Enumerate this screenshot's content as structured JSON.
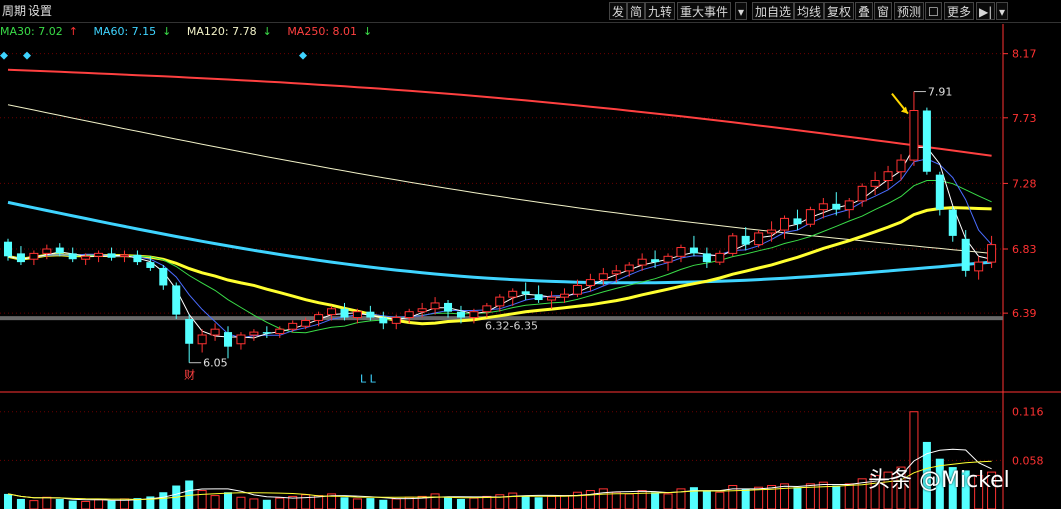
{
  "toolbar": {
    "left": [
      "周期",
      "设置"
    ],
    "right": [
      "发",
      "简",
      "九转",
      "重大事件",
      "▾",
      "加自选",
      "均线",
      "复权",
      "叠",
      "窗",
      "预测",
      "☐",
      "更多",
      "▶|",
      "▾"
    ]
  },
  "legend": [
    {
      "label": "MA30: 7.02",
      "arrow": "↑",
      "color": "#3adc48"
    },
    {
      "label": "MA60: 7.15",
      "arrow": "↓",
      "color": "#3fd4ff"
    },
    {
      "label": "MA120: 7.78",
      "arrow": "↓",
      "color": "#f2f2c8"
    },
    {
      "label": "MA250: 8.01",
      "arrow": "↓",
      "color": "#ff4040"
    }
  ],
  "colors": {
    "up": "#ff3232",
    "down": "#54ffff",
    "grid": "#6b0000",
    "axis": "#ff3232"
  },
  "chart_data": {
    "type": "candlestick",
    "y_ticks": [
      "8.17",
      "7.73",
      "7.28",
      "6.83",
      "6.39"
    ],
    "ylim": [
      6.0,
      8.25
    ],
    "volume_ticks": [
      "0.116",
      "0.058"
    ],
    "volume_ylim": [
      0,
      0.13
    ],
    "annotations": {
      "high": "7.91",
      "low": "6.05",
      "range": "6.32-6.35",
      "finance_marker": "财",
      "low_marks": "L L"
    },
    "candles": [
      [
        6.88,
        6.9,
        6.75,
        6.78
      ],
      [
        6.8,
        6.85,
        6.72,
        6.74
      ],
      [
        6.76,
        6.82,
        6.72,
        6.8
      ],
      [
        6.8,
        6.86,
        6.76,
        6.83
      ],
      [
        6.84,
        6.87,
        6.78,
        6.8
      ],
      [
        6.8,
        6.84,
        6.74,
        6.76
      ],
      [
        6.76,
        6.8,
        6.72,
        6.78
      ],
      [
        6.78,
        6.82,
        6.74,
        6.8
      ],
      [
        6.8,
        6.84,
        6.75,
        6.77
      ],
      [
        6.78,
        6.82,
        6.74,
        6.79
      ],
      [
        6.79,
        6.82,
        6.72,
        6.74
      ],
      [
        6.74,
        6.78,
        6.68,
        6.7
      ],
      [
        6.7,
        6.72,
        6.55,
        6.58
      ],
      [
        6.58,
        6.6,
        6.35,
        6.38
      ],
      [
        6.35,
        6.38,
        6.05,
        6.18
      ],
      [
        6.18,
        6.28,
        6.12,
        6.24
      ],
      [
        6.24,
        6.32,
        6.2,
        6.28
      ],
      [
        6.26,
        6.3,
        6.08,
        6.16
      ],
      [
        6.18,
        6.26,
        6.14,
        6.24
      ],
      [
        6.24,
        6.28,
        6.2,
        6.26
      ],
      [
        6.26,
        6.3,
        6.22,
        6.25
      ],
      [
        6.25,
        6.3,
        6.22,
        6.28
      ],
      [
        6.28,
        6.34,
        6.26,
        6.32
      ],
      [
        6.3,
        6.36,
        6.28,
        6.34
      ],
      [
        6.34,
        6.4,
        6.3,
        6.38
      ],
      [
        6.38,
        6.44,
        6.34,
        6.42
      ],
      [
        6.42,
        6.46,
        6.34,
        6.36
      ],
      [
        6.36,
        6.42,
        6.32,
        6.4
      ],
      [
        6.4,
        6.44,
        6.34,
        6.36
      ],
      [
        6.36,
        6.4,
        6.28,
        6.32
      ],
      [
        6.32,
        6.38,
        6.28,
        6.36
      ],
      [
        6.36,
        6.42,
        6.32,
        6.4
      ],
      [
        6.4,
        6.46,
        6.36,
        6.42
      ],
      [
        6.42,
        6.5,
        6.38,
        6.46
      ],
      [
        6.46,
        6.48,
        6.36,
        6.4
      ],
      [
        6.4,
        6.44,
        6.32,
        6.36
      ],
      [
        6.36,
        6.42,
        6.32,
        6.4
      ],
      [
        6.4,
        6.46,
        6.36,
        6.44
      ],
      [
        6.44,
        6.52,
        6.4,
        6.5
      ],
      [
        6.5,
        6.56,
        6.44,
        6.54
      ],
      [
        6.54,
        6.6,
        6.48,
        6.52
      ],
      [
        6.52,
        6.58,
        6.46,
        6.48
      ],
      [
        6.48,
        6.54,
        6.42,
        6.5
      ],
      [
        6.5,
        6.56,
        6.46,
        6.52
      ],
      [
        6.52,
        6.62,
        6.5,
        6.58
      ],
      [
        6.58,
        6.66,
        6.54,
        6.62
      ],
      [
        6.62,
        6.7,
        6.58,
        6.66
      ],
      [
        6.66,
        6.72,
        6.6,
        6.68
      ],
      [
        6.68,
        6.74,
        6.64,
        6.72
      ],
      [
        6.72,
        6.8,
        6.68,
        6.76
      ],
      [
        6.76,
        6.82,
        6.7,
        6.74
      ],
      [
        6.74,
        6.8,
        6.68,
        6.78
      ],
      [
        6.78,
        6.86,
        6.74,
        6.84
      ],
      [
        6.84,
        6.92,
        6.78,
        6.8
      ],
      [
        6.8,
        6.84,
        6.7,
        6.74
      ],
      [
        6.74,
        6.82,
        6.72,
        6.8
      ],
      [
        6.8,
        6.94,
        6.78,
        6.92
      ],
      [
        6.92,
        6.98,
        6.82,
        6.86
      ],
      [
        6.86,
        6.96,
        6.84,
        6.94
      ],
      [
        6.94,
        7.02,
        6.88,
        6.96
      ],
      [
        6.96,
        7.06,
        6.9,
        7.04
      ],
      [
        7.04,
        7.1,
        6.96,
        7.0
      ],
      [
        7.0,
        7.12,
        6.98,
        7.1
      ],
      [
        7.1,
        7.18,
        7.04,
        7.14
      ],
      [
        7.14,
        7.22,
        7.06,
        7.1
      ],
      [
        7.1,
        7.18,
        7.04,
        7.16
      ],
      [
        7.16,
        7.28,
        7.12,
        7.26
      ],
      [
        7.26,
        7.36,
        7.2,
        7.3
      ],
      [
        7.3,
        7.4,
        7.24,
        7.36
      ],
      [
        7.36,
        7.48,
        7.3,
        7.44
      ],
      [
        7.44,
        7.91,
        7.4,
        7.78
      ],
      [
        7.78,
        7.8,
        7.34,
        7.36
      ],
      [
        7.34,
        7.36,
        7.06,
        7.1
      ],
      [
        7.1,
        7.12,
        6.88,
        6.92
      ],
      [
        6.9,
        6.96,
        6.64,
        6.68
      ],
      [
        6.68,
        6.78,
        6.62,
        6.74
      ],
      [
        6.74,
        6.92,
        6.7,
        6.86
      ]
    ],
    "volumes": [
      0.018,
      0.012,
      0.01,
      0.014,
      0.012,
      0.01,
      0.009,
      0.011,
      0.01,
      0.012,
      0.013,
      0.015,
      0.02,
      0.028,
      0.034,
      0.022,
      0.016,
      0.02,
      0.014,
      0.012,
      0.011,
      0.013,
      0.015,
      0.017,
      0.016,
      0.018,
      0.014,
      0.012,
      0.013,
      0.011,
      0.012,
      0.014,
      0.015,
      0.018,
      0.014,
      0.012,
      0.013,
      0.015,
      0.017,
      0.019,
      0.016,
      0.014,
      0.015,
      0.016,
      0.02,
      0.022,
      0.024,
      0.02,
      0.018,
      0.022,
      0.02,
      0.018,
      0.024,
      0.026,
      0.022,
      0.02,
      0.028,
      0.024,
      0.026,
      0.028,
      0.03,
      0.026,
      0.03,
      0.032,
      0.028,
      0.03,
      0.036,
      0.04,
      0.044,
      0.05,
      0.116,
      0.08,
      0.06,
      0.05,
      0.046,
      0.04,
      0.044
    ],
    "series": [
      {
        "name": "MA250",
        "color": "#ff4040",
        "values_start": 8.06,
        "values_end": 7.47
      },
      {
        "name": "MA120",
        "color": "#f2f2c8",
        "values_start": 7.82,
        "values_end": 6.8
      },
      {
        "name": "MA60",
        "color": "#3fd4ff",
        "values_start": 7.15,
        "values_end": 6.74
      },
      {
        "name": "MA30",
        "color": "#3adc48",
        "values_start": 7.02,
        "values_end": 7.02
      }
    ]
  },
  "watermark": "头条 @Mickel"
}
